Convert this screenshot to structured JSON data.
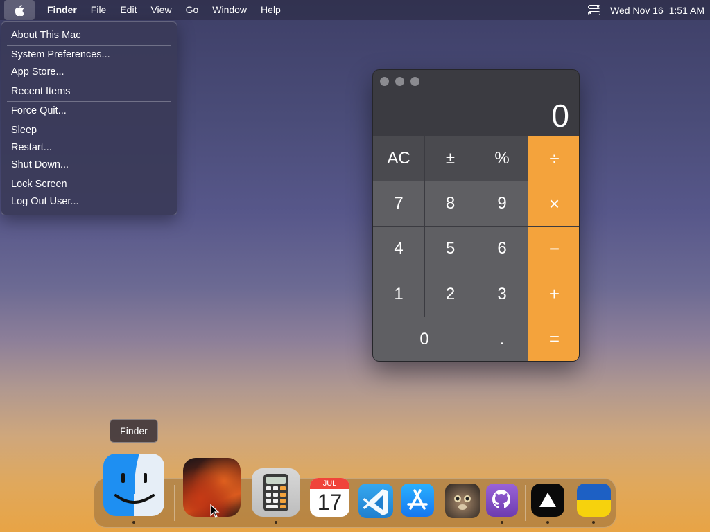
{
  "menubar": {
    "apple_icon": "apple-logo-icon",
    "app_name": "Finder",
    "items": [
      "File",
      "Edit",
      "View",
      "Go",
      "Window",
      "Help"
    ],
    "control_center_icon": "control-center-icon",
    "clock": "Wed Nov 16  1:51 AM"
  },
  "apple_menu": {
    "items": [
      {
        "label": "About This Mac"
      },
      {
        "label": "System Preferences..."
      },
      {
        "label": "App Store..."
      },
      {
        "label": "Recent Items"
      },
      {
        "label": "Force Quit..."
      },
      {
        "label": "Sleep"
      },
      {
        "label": "Restart..."
      },
      {
        "label": "Shut Down..."
      },
      {
        "label": "Lock Screen"
      },
      {
        "label": "Log Out User..."
      }
    ]
  },
  "calculator": {
    "display": "0",
    "keys": {
      "ac": "AC",
      "plus_minus": "±",
      "percent": "%",
      "divide": "÷",
      "seven": "7",
      "eight": "8",
      "nine": "9",
      "multiply": "×",
      "four": "4",
      "five": "5",
      "six": "6",
      "minus": "−",
      "one": "1",
      "two": "2",
      "three": "3",
      "plus": "+",
      "zero": "0",
      "decimal": ".",
      "equals": "="
    },
    "colors": {
      "operator": "#f4a33c",
      "digit": "#5f5f63",
      "function": "#4a4a4f"
    }
  },
  "tooltip": {
    "text": "Finder"
  },
  "dock": {
    "calendar": {
      "month": "JUL",
      "day": "17"
    },
    "apps": [
      "finder-icon",
      "ventura-wallpaper-icon",
      "calculator-icon",
      "calendar-icon",
      "vscode-icon",
      "app-store-icon",
      "cat-app-icon",
      "github-desktop-icon",
      "vercel-icon",
      "ukraine-flag-icon"
    ]
  }
}
